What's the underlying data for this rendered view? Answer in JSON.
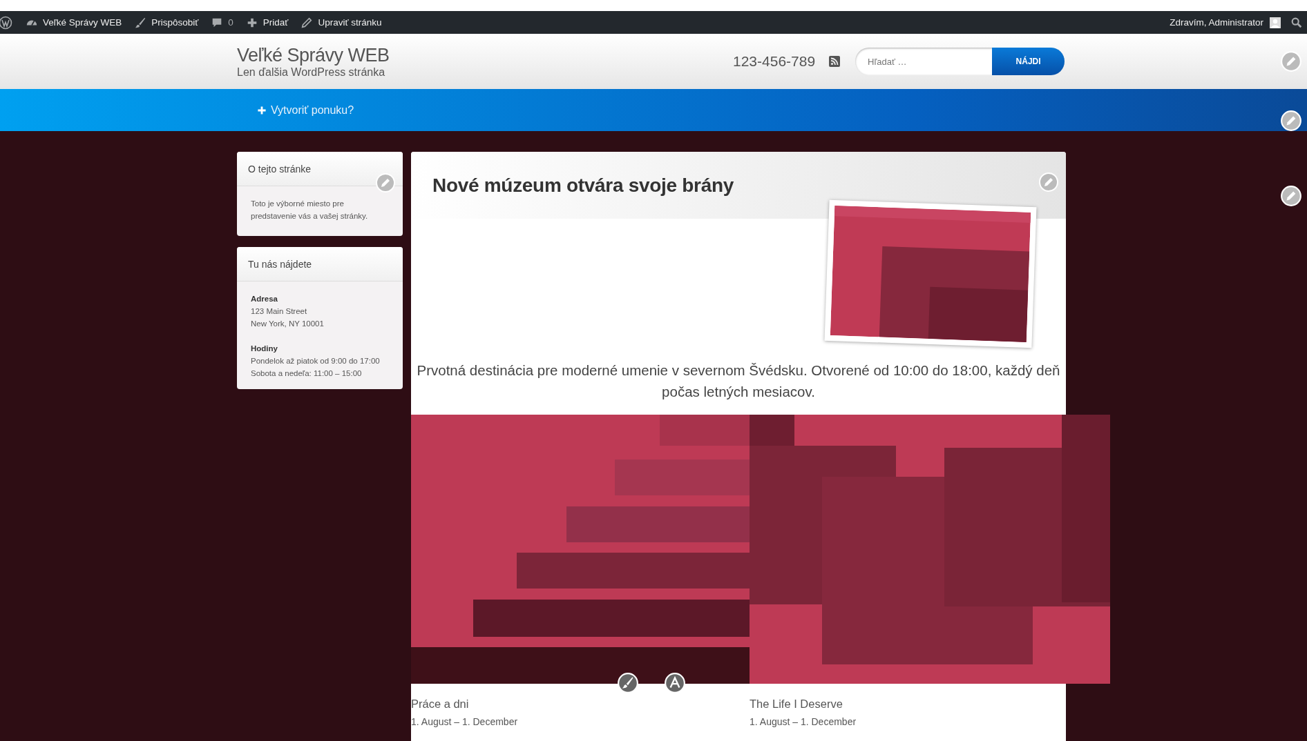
{
  "admin_bar": {
    "items": [
      {
        "kind": "wp-logo"
      },
      {
        "kind": "dashboard",
        "label": "Veľké Správy WEB"
      },
      {
        "kind": "customize",
        "label": "Prispôsobiť"
      },
      {
        "kind": "comments",
        "label": "0"
      },
      {
        "kind": "new",
        "label": "Pridať"
      },
      {
        "kind": "edit",
        "label": "Upraviť stránku"
      }
    ],
    "greeting": "Zdravím, Administrator"
  },
  "header": {
    "site_title": "Veľké Správy WEB",
    "tagline": "Len ďalšia WordPress stránka",
    "phone": "123-456-789",
    "search": {
      "placeholder": "Hľadať …",
      "button": "NÁJDI"
    }
  },
  "nav": {
    "create_menu": "Vytvoriť ponuku?"
  },
  "sidebar": {
    "widgets": [
      {
        "kind": "text",
        "title": "O tejto stránke",
        "text": "Toto je výborné miesto pre predstavenie vás a vašej stránky."
      },
      {
        "kind": "contact",
        "title": "Tu nás nájdete",
        "sections": [
          {
            "heading": "Adresa",
            "lines": [
              "123 Main Street",
              "New York, NY 10001"
            ]
          },
          {
            "heading": "Hodiny",
            "lines": [
              "Pondelok až piatok od 9:00 do 17:00",
              "Sobota a nedeľa: 11:00 – 15:00"
            ]
          }
        ]
      }
    ]
  },
  "main": {
    "title": "Nové múzeum otvára svoje brány",
    "description": "Prvotná destinácia pre moderné umenie v severnom Švédsku. Otvorené od 10:00 do 18:00, každý deň počas letných mesiacov.",
    "gallery": [
      {
        "title": "Práce a dni",
        "dates": "1. August – 1. December"
      },
      {
        "title": "The Life I Deserve",
        "dates": "1. August – 1. December"
      }
    ]
  }
}
